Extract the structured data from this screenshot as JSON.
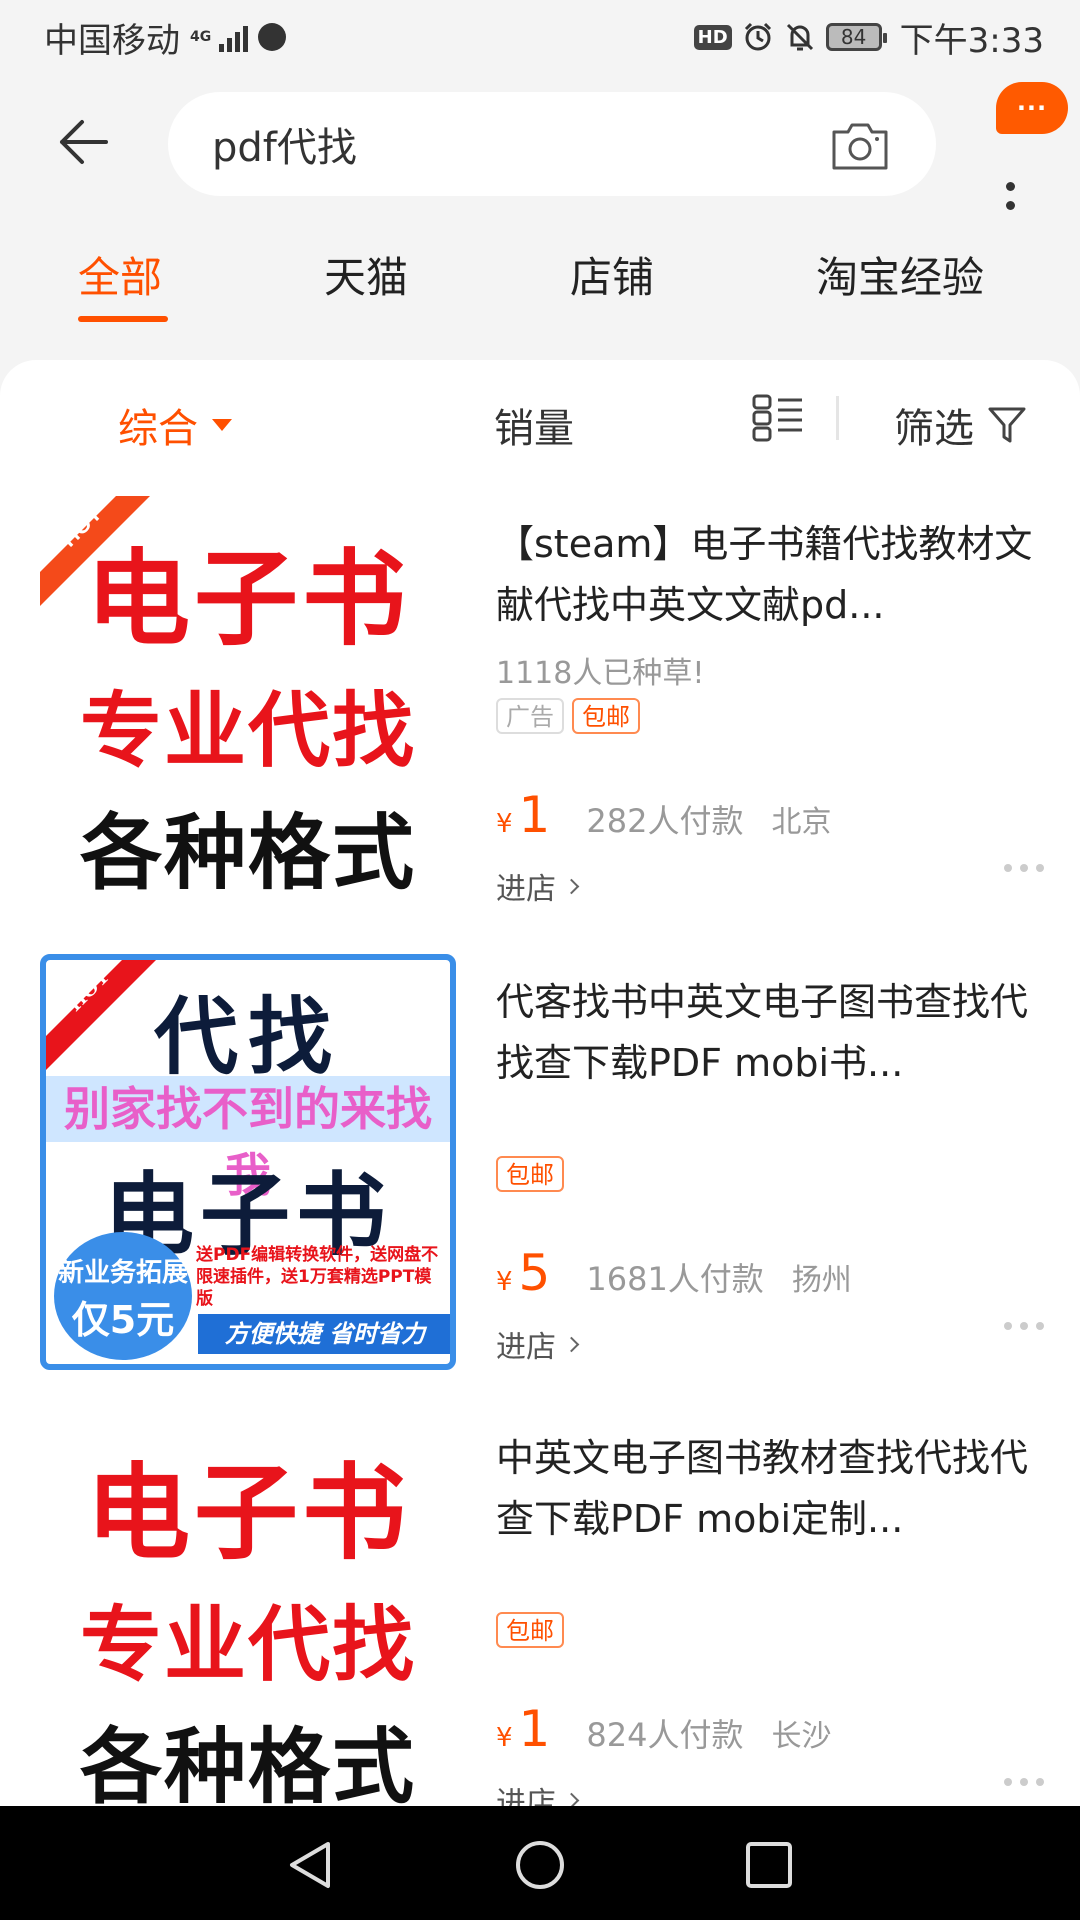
{
  "status_bar": {
    "carrier": "中国移动",
    "network": "4G",
    "hd": "HD",
    "battery": "84",
    "time": "下午3:33"
  },
  "search": {
    "query": "pdf代找",
    "bubble": "···"
  },
  "tabs": [
    {
      "label": "全部",
      "active": true
    },
    {
      "label": "天猫",
      "active": false
    },
    {
      "label": "店铺",
      "active": false
    },
    {
      "label": "淘宝经验",
      "active": false
    }
  ],
  "sort_bar": {
    "comprehensive": "综合",
    "sales": "销量",
    "filter": "筛选"
  },
  "products": [
    {
      "title": "【steam】电子书籍代找教材文献代找中英文文献pd...",
      "subtitle": "1118人已种草!",
      "tag_ad": "广告",
      "tag_ship": "包邮",
      "currency": "¥",
      "price": "1",
      "sold": "282人付款",
      "city": "北京",
      "shop": "进店",
      "image": {
        "line1": "电子书",
        "line2": "专业代找",
        "line3": "各种格式",
        "hot": "HOT"
      }
    },
    {
      "title": "代客找书中英文电子图书查找代找查下载PDF mobi书...",
      "tag_ship": "包邮",
      "currency": "¥",
      "price": "5",
      "sold": "1681人付款",
      "city": "扬州",
      "shop": "进店",
      "image": {
        "line1": "代找",
        "line2": "别家找不到的来找我",
        "line3": "电子书",
        "promo": "送PDF编辑转换软件，送网盘不限速插件，送1万套精选PPT模版",
        "badge1": "新业务拓展",
        "badge2": "仅5元",
        "slogan": "方便快捷 省时省力",
        "hot": "HOT"
      }
    },
    {
      "title": "中英文电子图书教材查找代找代查下载PDF mobi定制...",
      "tag_ship": "包邮",
      "currency": "¥",
      "price": "1",
      "sold": "824人付款",
      "city": "长沙",
      "shop": "进店",
      "image": {
        "line1": "电子书",
        "line2": "专业代找",
        "line3": "各种格式"
      }
    }
  ]
}
